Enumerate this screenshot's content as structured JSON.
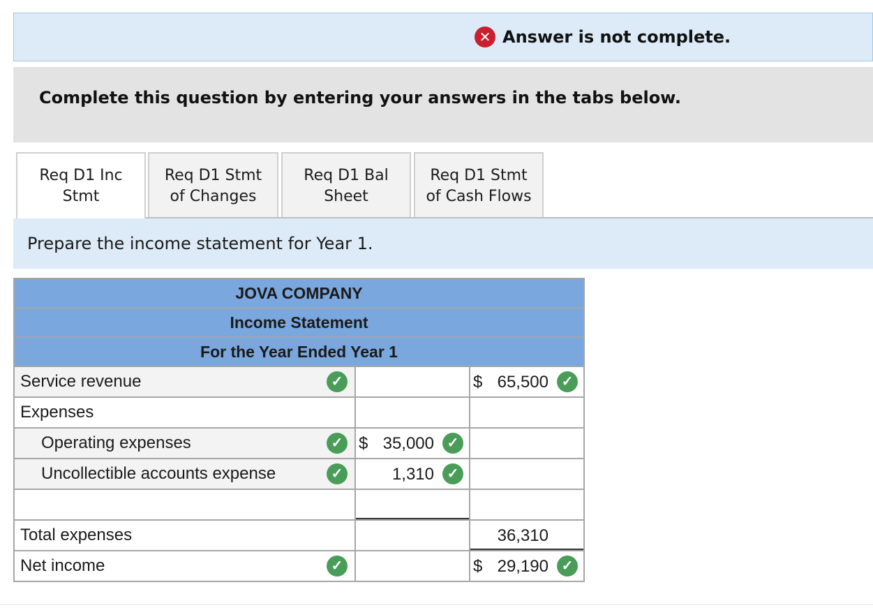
{
  "banner": {
    "message": "Answer is not complete."
  },
  "instructions": "Complete this question by entering your answers in the tabs below.",
  "tabs": [
    {
      "label": "Req D1 Inc\nStmt",
      "active": true
    },
    {
      "label": "Req D1 Stmt\nof Changes",
      "active": false
    },
    {
      "label": "Req D1 Bal\nSheet",
      "active": false
    },
    {
      "label": "Req D1 Stmt\nof Cash Flows",
      "active": false
    }
  ],
  "prompt": "Prepare the income statement for Year 1.",
  "statement": {
    "company": "JOVA COMPANY",
    "title": "Income Statement",
    "period": "For the Year Ended Year 1",
    "rows": {
      "service_revenue": {
        "label": "Service revenue",
        "col3": "65,500",
        "col3_dollar": "$"
      },
      "expenses": {
        "label": "Expenses"
      },
      "operating": {
        "label": "Operating expenses",
        "col2": "35,000",
        "col2_dollar": "$"
      },
      "uncollectible": {
        "label": "Uncollectible accounts expense",
        "col2": "1,310"
      },
      "total": {
        "label": "Total expenses",
        "col3": "36,310"
      },
      "net": {
        "label": "Net income",
        "col3": "29,190",
        "col3_dollar": "$"
      }
    }
  },
  "icons": {
    "check": "✓",
    "x": "✕"
  },
  "colors": {
    "header_blue": "#7aa7dd",
    "banner_blue": "#dcebf7",
    "check_green": "#4a9d58",
    "error_red": "#c8202e"
  }
}
